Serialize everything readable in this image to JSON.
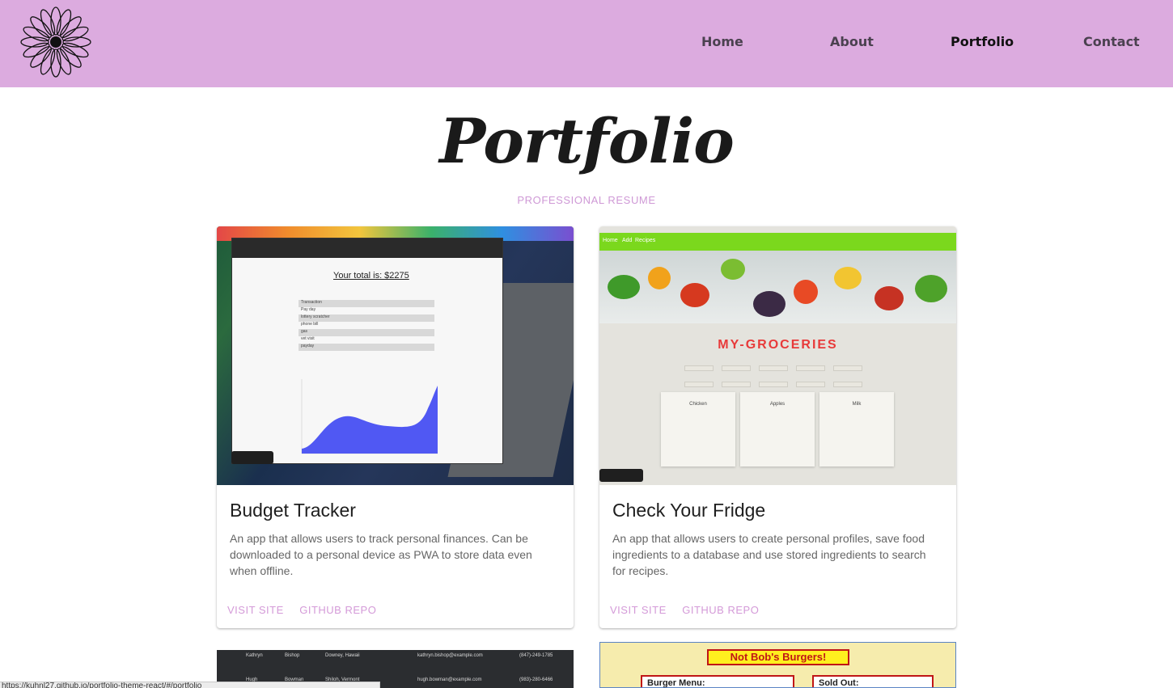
{
  "header": {
    "nav": [
      {
        "label": "Home",
        "active": false
      },
      {
        "label": "About",
        "active": false
      },
      {
        "label": "Portfolio",
        "active": true
      },
      {
        "label": "Contact",
        "active": false
      }
    ],
    "logo_icon": "daisy-flower-icon",
    "bg_color": "#dcabdf"
  },
  "page": {
    "title": "Portfolio",
    "resume_link": "PROFESSIONAL RESUME"
  },
  "cards": [
    {
      "title": "Budget Tracker",
      "description": "An app that allows users to track personal finances. Can be downloaded to a personal device as PWA to store data even when offline.",
      "actions": [
        "VISIT SITE",
        "GITHUB REPO"
      ],
      "screenshot": {
        "total": "Your total is: $2275",
        "rows": [
          "Transaction",
          "Pay day",
          "lottery scratcher",
          "phone bill",
          "gas",
          "vet visit",
          "payday"
        ]
      }
    },
    {
      "title": "Check Your Fridge",
      "description": "An app that allows users to create personal profiles, save food ingredients to a database and use stored ingredients to search for recipes.",
      "actions": [
        "VISIT SITE",
        "GITHUB REPO"
      ],
      "screenshot": {
        "nav": [
          "Home",
          "Add",
          "Recipes"
        ],
        "logo": "MY-GROCERIES",
        "items": [
          "Chicken",
          "Apples",
          "Milk"
        ]
      }
    }
  ],
  "bottom_cards": {
    "left_rows": [
      {
        "first": "Kathryn",
        "last": "Bishop",
        "place": "Downey, Hawaii",
        "email": "kathryn.bishop@example.com",
        "phone": "(847)-249-1785"
      },
      {
        "first": "Hugh",
        "last": "Bowman",
        "place": "Shiloh, Vermont",
        "email": "hugh.bowman@example.com",
        "phone": "(983)-280-6466"
      }
    ],
    "right_banner": "Not Bob's Burgers!",
    "right_menu": "Burger Menu:",
    "right_sold": "Sold Out:"
  },
  "status_url": "https://kuhnl27.github.io/portfolio-theme-react/#/portfolio"
}
